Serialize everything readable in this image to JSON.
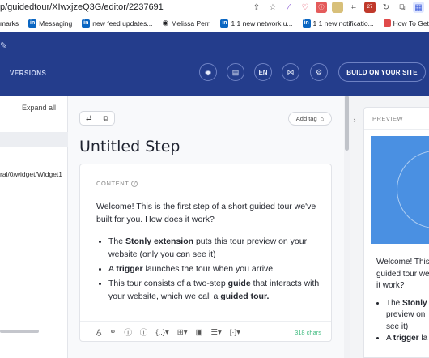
{
  "browser": {
    "url": "p/guidedtour/XIwxjzeQ3G/editor/2237691",
    "bookmarks": [
      {
        "label": "marks",
        "icon": "none"
      },
      {
        "label": "Messaging",
        "icon": "linkedin-icon"
      },
      {
        "label": "new feed updates...",
        "icon": "linkedin-icon"
      },
      {
        "label": "Melissa Perri",
        "icon": "globe-icon"
      },
      {
        "label": "1 1 new network u...",
        "icon": "linkedin-icon"
      },
      {
        "label": "1 1 new notificatio...",
        "icon": "linkedin-icon"
      },
      {
        "label": "How To Get Starte...",
        "icon": "bookmark-icon"
      }
    ]
  },
  "header": {
    "versions_label": "VERSIONS",
    "language": "EN",
    "build_label": "BUILD ON YOUR SITE"
  },
  "left_panel": {
    "expand_all": "Expand all",
    "path": "ral/0/widget/Widget1"
  },
  "editor": {
    "add_tag": "Add tag",
    "step_title": "Untitled Step",
    "content_label": "CONTENT",
    "intro": "Welcome! This is the first step of a short guided tour we've built for you. How does it work?",
    "bullets": [
      {
        "pre": "The ",
        "bold": "Stonly extension",
        "post": " puts this tour preview on your website (only you can see it)"
      },
      {
        "pre": "A ",
        "bold": "trigger",
        "post": " launches the tour when you arrive"
      },
      {
        "pre": "This tour consists of a two-step ",
        "bold": "guide",
        "post": " that interacts with your website, which we call a ",
        "bold2": "guided tour."
      }
    ],
    "char_count": "318 chars"
  },
  "preview": {
    "label": "PREVIEW",
    "text_lines": [
      "Welcome! This",
      "guided tour we",
      "it work?"
    ],
    "bullet1_lines": [
      {
        "pre": "The ",
        "bold": "Stonly"
      },
      {
        "pre": "preview on"
      },
      {
        "pre": "see it)"
      }
    ],
    "bullet2": {
      "pre": "A ",
      "bold": "trigger",
      "post": " la"
    }
  },
  "colors": {
    "header_bg": "#243d8c",
    "preview_image": "#4a90e2",
    "char_count": "#3dba7e"
  }
}
